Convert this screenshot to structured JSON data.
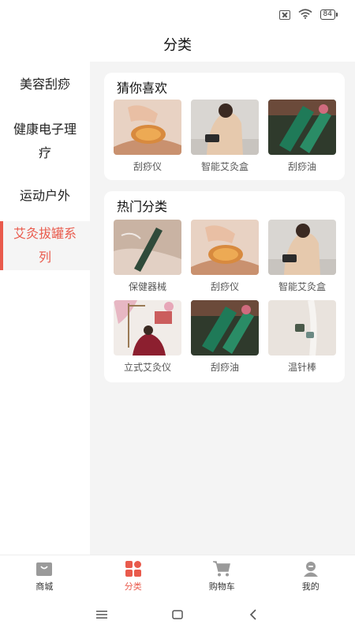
{
  "status_bar": {
    "battery": "84"
  },
  "header": {
    "title": "分类"
  },
  "sidebar": {
    "items": [
      {
        "label": "美容刮痧",
        "active": false
      },
      {
        "label": "健康电子理疗",
        "active": false
      },
      {
        "label": "运动户外",
        "active": false
      },
      {
        "label": "艾灸拔罐系列",
        "active": true
      }
    ]
  },
  "guess": {
    "title": "猜你喜欢",
    "items": [
      {
        "label": "刮痧仪",
        "image": "gua-sha-device"
      },
      {
        "label": "智能艾灸盒",
        "image": "moxibustion-box"
      },
      {
        "label": "刮痧油",
        "image": "gua-sha-oil"
      }
    ]
  },
  "hot": {
    "title": "热门分类",
    "items": [
      {
        "label": "保健器械",
        "image": "health-device"
      },
      {
        "label": "刮痧仪",
        "image": "gua-sha-device"
      },
      {
        "label": "智能艾灸盒",
        "image": "moxibustion-box"
      },
      {
        "label": "立式艾灸仪",
        "image": "standing-moxibustion"
      },
      {
        "label": "刮痧油",
        "image": "gua-sha-oil"
      },
      {
        "label": "温针棒",
        "image": "warm-needle"
      }
    ]
  },
  "tabbar": {
    "tabs": [
      {
        "label": "商城",
        "icon": "shop-bag-icon",
        "active": false
      },
      {
        "label": "分类",
        "icon": "category-grid-icon",
        "active": true
      },
      {
        "label": "购物车",
        "icon": "cart-icon",
        "active": false
      },
      {
        "label": "我的",
        "icon": "profile-icon",
        "active": false
      }
    ]
  },
  "colors": {
    "accent": "#e95a4c",
    "tab_inactive": "#9a9a9a",
    "background": "#f4f4f4"
  }
}
